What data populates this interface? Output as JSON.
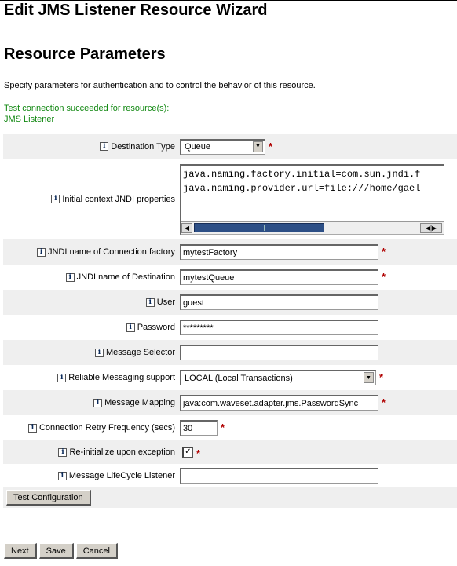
{
  "page": {
    "wizard_title": "Edit JMS Listener Resource Wizard",
    "section_title": "Resource Parameters",
    "intro": "Specify parameters for authentication and to control the behavior of this resource.",
    "status_line1": "Test connection succeeded for resource(s):",
    "status_line2": "JMS Listener",
    "status_color": "#118811",
    "required_marker": "*"
  },
  "icons": {
    "info": "i",
    "dropdown_arrow": "▼",
    "scroll_left": "◀",
    "scroll_right": "◀|▶",
    "check": "✓"
  },
  "fields": {
    "destination_type": {
      "label": "Destination Type",
      "value": "Queue",
      "required": true
    },
    "jndi_props": {
      "label": "Initial context JNDI properties",
      "line1": "java.naming.factory.initial=com.sun.jndi.f",
      "line2": "java.naming.provider.url=file:///home/gael"
    },
    "connection_factory": {
      "label": "JNDI name of Connection factory",
      "value": "mytestFactory",
      "required": true
    },
    "destination": {
      "label": "JNDI name of Destination",
      "value": "mytestQueue",
      "required": true
    },
    "user": {
      "label": "User",
      "value": "guest"
    },
    "password": {
      "label": "Password",
      "value": "*********"
    },
    "message_selector": {
      "label": "Message Selector",
      "value": ""
    },
    "reliable_messaging": {
      "label": "Reliable Messaging support",
      "value": "LOCAL (Local Transactions)",
      "required": true
    },
    "message_mapping": {
      "label": "Message Mapping",
      "value": "java:com.waveset.adapter.jms.PasswordSync",
      "required": true
    },
    "retry_frequency": {
      "label": "Connection Retry Frequency (secs)",
      "value": "30",
      "required": true
    },
    "reinitialize": {
      "label": "Re-initialize upon exception",
      "checked": true,
      "required": true
    },
    "lifecycle_listener": {
      "label": "Message LifeCycle Listener",
      "value": ""
    }
  },
  "buttons": {
    "test": "Test Configuration",
    "next": "Next",
    "save": "Save",
    "cancel": "Cancel"
  }
}
